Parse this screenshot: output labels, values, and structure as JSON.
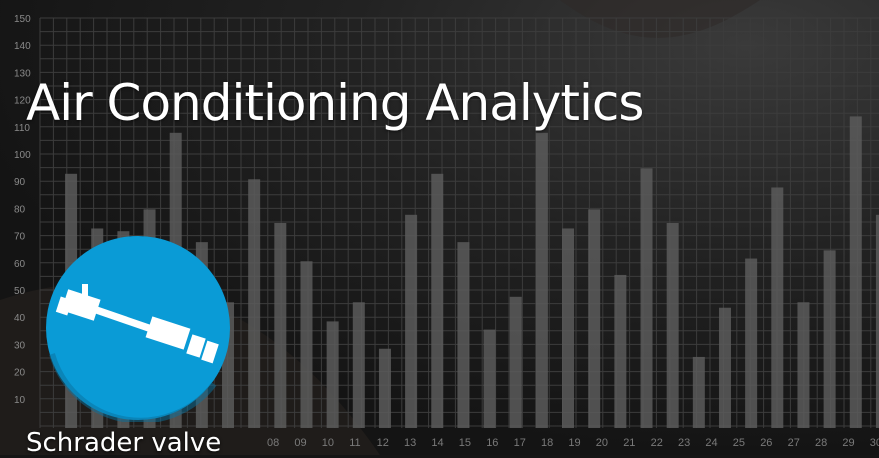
{
  "title": "Air Conditioning Analytics",
  "caption": "Schrader valve",
  "icon": {
    "name": "schrader-valve-icon",
    "color": "#0a9bd6"
  },
  "background": {
    "y_ticks": [
      "150",
      "140",
      "130",
      "120",
      "110",
      "100",
      "90",
      "80",
      "70",
      "60",
      "50",
      "40",
      "30",
      "20",
      "10"
    ],
    "x_ticks": [
      "08",
      "09",
      "10",
      "11",
      "12",
      "13",
      "14",
      "15",
      "16",
      "17",
      "18",
      "19",
      "20",
      "21",
      "22",
      "23",
      "24",
      "25",
      "26",
      "27",
      "28",
      "29",
      "30"
    ],
    "bar_values": [
      93,
      73,
      72,
      80,
      108,
      68,
      46,
      91,
      75,
      61,
      39,
      46,
      29,
      78,
      93,
      68,
      36,
      48,
      108,
      73,
      80,
      56,
      95,
      75,
      26,
      44,
      62,
      88,
      46,
      65,
      114,
      78
    ]
  }
}
